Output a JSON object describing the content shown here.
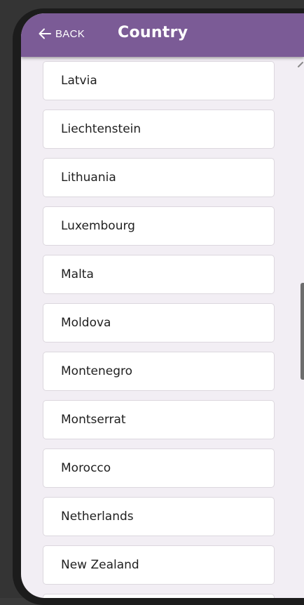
{
  "header": {
    "back_label": "BACK",
    "title": "Country",
    "color": "#7b5b96"
  },
  "countries": [
    "Latvia",
    "Liechtenstein",
    "Lithuania",
    "Luxembourg",
    "Malta",
    "Moldova",
    "Montenegro",
    "Montserrat",
    "Morocco",
    "Netherlands",
    "New Zealand",
    ""
  ],
  "icons": {
    "back": "arrow-left-icon"
  }
}
